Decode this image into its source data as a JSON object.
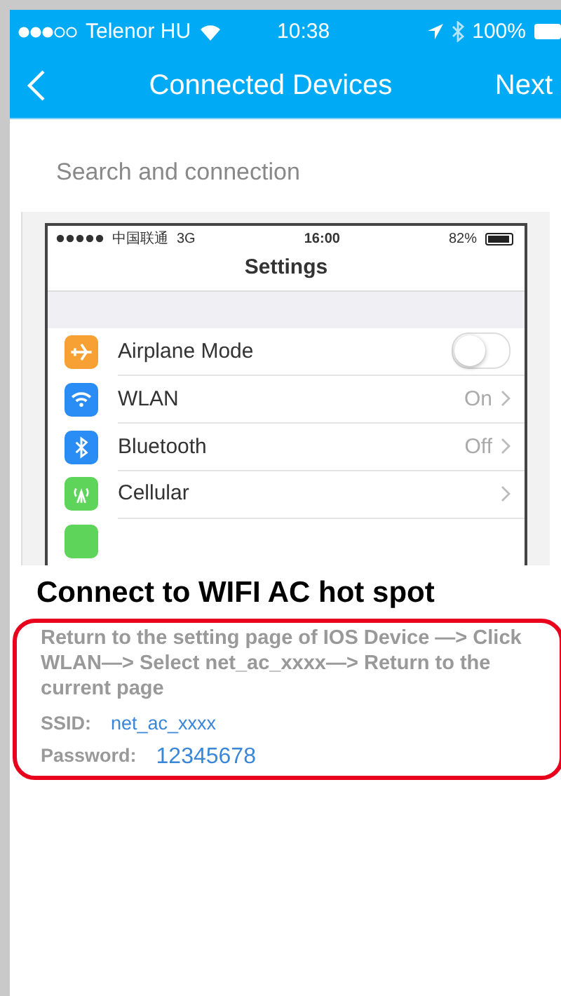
{
  "status_bar": {
    "carrier": "Telenor HU",
    "time": "10:38",
    "battery": "100%"
  },
  "nav_bar": {
    "title": "Connected Devices",
    "next": "Next"
  },
  "section_label": "Search and connection",
  "guide_image": {
    "status_bar": {
      "carrier": "中国联通",
      "network": "3G",
      "time": "16:00",
      "battery": "82%"
    },
    "title": "Settings",
    "rows": [
      {
        "kind": "toggle",
        "label": "Airplane Mode",
        "on": false,
        "color": "#f7a033"
      },
      {
        "kind": "detail",
        "label": "WLAN",
        "value": "On",
        "color": "#2a8cf5"
      },
      {
        "kind": "detail",
        "label": "Bluetooth",
        "value": "Off",
        "color": "#2a8cf5"
      },
      {
        "kind": "detail",
        "label": "Cellular",
        "color": "#5fd45a"
      },
      {
        "kind": "cut",
        "color": "#5fd45a"
      }
    ]
  },
  "instruction": {
    "title": "Connect to WIFI AC hot spot",
    "text": "Return to the setting page of IOS Device —> Click WLAN—> Select net_ac_xxxx—> Return to the current page",
    "ssid_label": "SSID:",
    "ssid": "net_ac_xxxx",
    "password_label": "Password:",
    "password": "12345678"
  }
}
